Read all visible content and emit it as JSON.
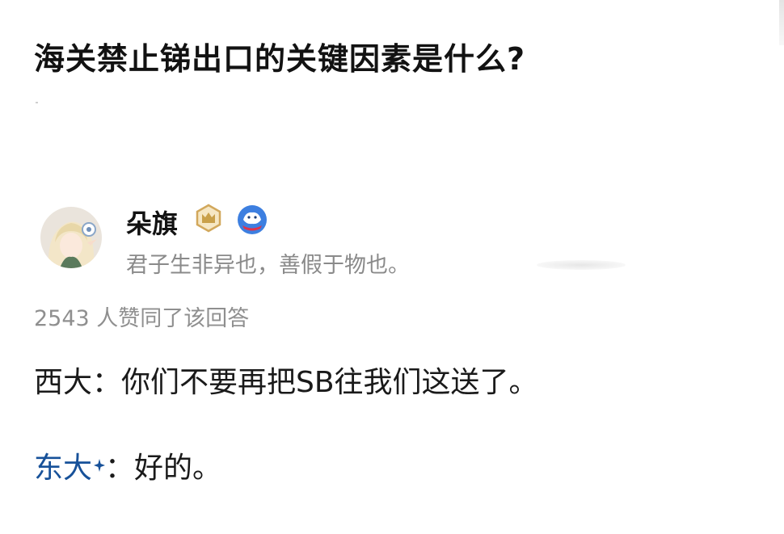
{
  "question": {
    "title": "海关禁止锑出口的关键因素是什么?"
  },
  "author": {
    "name": "朵旗",
    "bio": "君子生非异也，善假于物也。",
    "badges": [
      "crown-badge-icon",
      "bird-badge-icon"
    ]
  },
  "answer": {
    "vote_text": "2543 人赞同了该回答",
    "line1": "西大：你们不要再把SB往我们这送了。",
    "line2_link": "东大",
    "line2_rest": "：好的。"
  },
  "colors": {
    "link": "#175199",
    "meta_gray": "#8a8a8a",
    "badge_gold": "#c9a04a",
    "badge_blue": "#3d7fe0"
  }
}
